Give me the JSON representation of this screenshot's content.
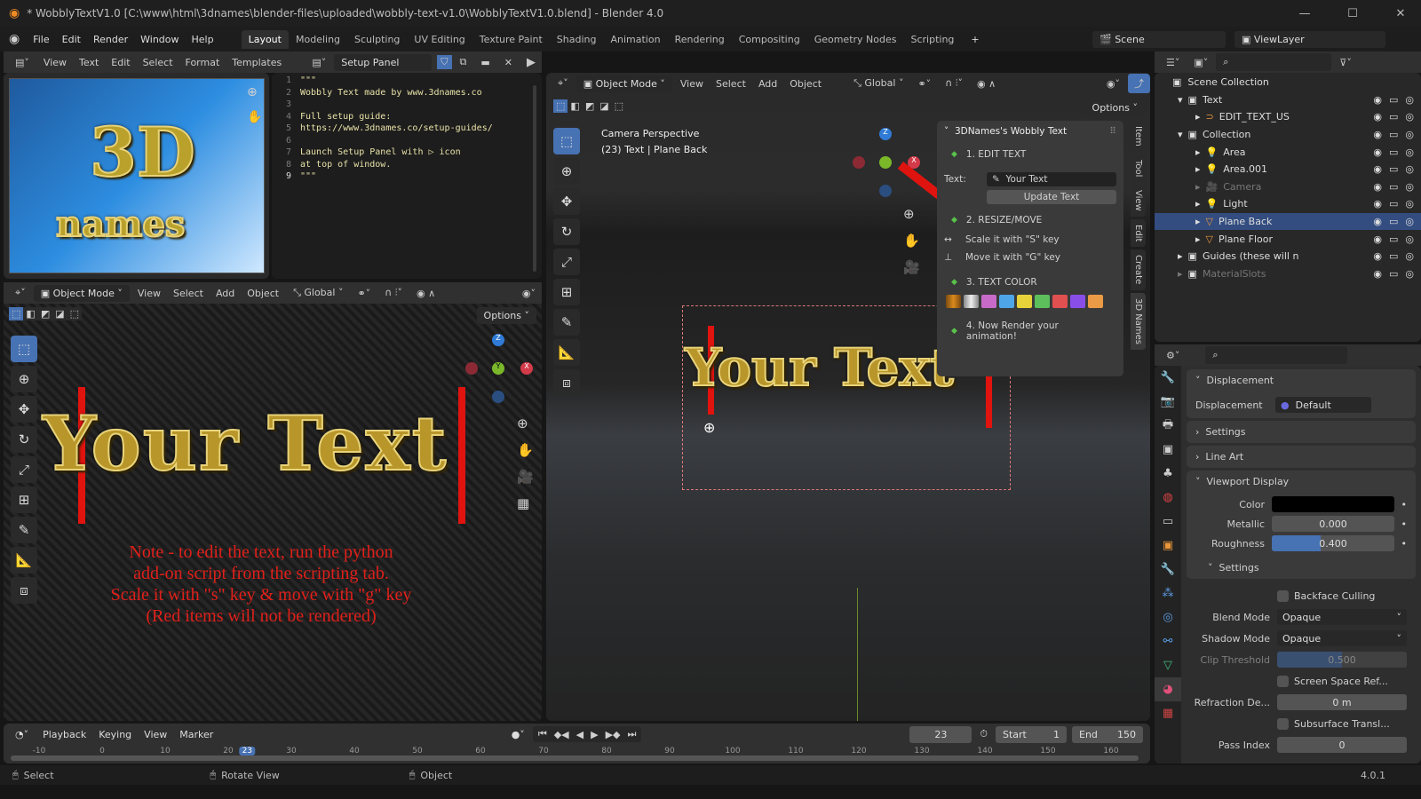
{
  "title_bar": {
    "title": "* WobblyTextV1.0 [C:\\www\\html\\3dnames\\blender-files\\uploaded\\wobbly-text-v1.0\\WobblyTextV1.0.blend] - Blender 4.0"
  },
  "menu": [
    "File",
    "Edit",
    "Render",
    "Window",
    "Help"
  ],
  "workspaces": [
    "Layout",
    "Modeling",
    "Sculpting",
    "UV Editing",
    "Texture Paint",
    "Shading",
    "Animation",
    "Rendering",
    "Compositing",
    "Geometry Nodes",
    "Scripting"
  ],
  "active_workspace": "Layout",
  "scene": {
    "name": "Scene",
    "view_layer": "ViewLayer"
  },
  "text_editor": {
    "menu": [
      "View",
      "Text",
      "Edit",
      "Select",
      "Format",
      "Templates"
    ],
    "file_name": "Setup Panel",
    "lines": [
      "\"\"\"",
      "Wobbly Text made by www.3dnames.co",
      "",
      "Full setup guide:",
      "https://www.3dnames.co/setup-guides/",
      "",
      "Launch Setup Panel with ▷ icon",
      "at top of window.",
      "\"\"\""
    ],
    "current_line": 9
  },
  "image_logo": {
    "text_top": "3D",
    "text_bottom": "names"
  },
  "left_viewport": {
    "mode": "Object Mode",
    "menu": [
      "View",
      "Select",
      "Add",
      "Object"
    ],
    "orientation": "Global",
    "options_label": "Options",
    "big_text": "Your Text",
    "note_lines": [
      "Note - to edit the text, run the python",
      "add-on script from the scripting tab.",
      "Scale it with \"s\" key & move with \"g\" key",
      "(Red items will not be rendered)"
    ]
  },
  "right_viewport": {
    "mode": "Object Mode",
    "menu": [
      "View",
      "Select",
      "Add",
      "Object"
    ],
    "orientation": "Global",
    "options_label": "Options",
    "overlay_title": "Camera Perspective",
    "overlay_subtitle": "(23) Text | Plane Back",
    "big_text": "Your Text"
  },
  "n_panel": {
    "title": "3DNames's Wobbly Text",
    "step1": "1. EDIT TEXT",
    "text_label": "Text:",
    "text_value": "Your Text",
    "update_button": "Update Text",
    "step2": "2. RESIZE/MOVE",
    "scale_hint": "Scale it with \"S\" key",
    "move_hint": "Move it with \"G\" key",
    "step3": "3. TEXT COLOR",
    "colors": [
      "#b8720f",
      "#c8c8c8",
      "#c86bc8",
      "#4ea6e8",
      "#e8d23a",
      "#5cbf5c",
      "#e05050",
      "#8a4ee8",
      "#eb9a45"
    ],
    "step4": "4. Now Render your animation!",
    "tabs": [
      "Item",
      "Tool",
      "View",
      "Edit",
      "Create",
      "3D Names"
    ]
  },
  "outliner": {
    "root": "Scene Collection",
    "items": [
      {
        "name": "Text",
        "depth": 0,
        "type": "collection",
        "expanded": true
      },
      {
        "name": "EDIT_TEXT_US",
        "depth": 1,
        "type": "curve"
      },
      {
        "name": "Collection",
        "depth": 0,
        "type": "collection",
        "expanded": true
      },
      {
        "name": "Area",
        "depth": 1,
        "type": "light"
      },
      {
        "name": "Area.001",
        "depth": 1,
        "type": "light"
      },
      {
        "name": "Camera",
        "depth": 1,
        "type": "camera",
        "dimmed": true
      },
      {
        "name": "Light",
        "depth": 1,
        "type": "light"
      },
      {
        "name": "Plane Back",
        "depth": 1,
        "type": "mesh",
        "selected": true
      },
      {
        "name": "Plane Floor",
        "depth": 1,
        "type": "mesh"
      },
      {
        "name": "Guides (these will n",
        "depth": 0,
        "type": "collection"
      },
      {
        "name": "MaterialSlots",
        "depth": 0,
        "type": "collection",
        "dimmed": true
      }
    ]
  },
  "properties": {
    "displacement_panel": "Displacement",
    "displacement_label": "Displacement",
    "displacement_value": "Default",
    "settings_panel": "Settings",
    "line_art_panel": "Line Art",
    "viewport_display_panel": "Viewport Display",
    "color_label": "Color",
    "color_value": "#000000",
    "metallic_label": "Metallic",
    "metallic_value": "0.000",
    "roughness_label": "Roughness",
    "roughness_value": "0.400",
    "roughness_fraction": 0.4,
    "settings_sub": "Settings",
    "backface_culling": "Backface Culling",
    "blend_mode_label": "Blend Mode",
    "blend_mode_value": "Opaque",
    "shadow_mode_label": "Shadow Mode",
    "shadow_mode_value": "Opaque",
    "clip_threshold_label": "Clip Threshold",
    "clip_threshold_value": "0.500",
    "clip_fraction": 0.5,
    "screen_space_ref": "Screen Space Ref...",
    "refraction_label": "Refraction De...",
    "refraction_value": "0 m",
    "subsurface": "Subsurface Transl...",
    "pass_index_label": "Pass Index",
    "pass_index_value": "0"
  },
  "timeline": {
    "menu": [
      "Playback",
      "Keying",
      "View",
      "Marker"
    ],
    "current_frame": "23",
    "start_label": "Start",
    "start": "1",
    "end_label": "End",
    "end": "150",
    "ticks": [
      "-10",
      "0",
      "10",
      "20",
      "30",
      "40",
      "50",
      "60",
      "70",
      "80",
      "90",
      "100",
      "110",
      "120",
      "130",
      "140",
      "150",
      "160"
    ]
  },
  "status_bar": {
    "select": "Select",
    "rotate": "Rotate View",
    "object": "Object",
    "version": "4.0.1"
  }
}
